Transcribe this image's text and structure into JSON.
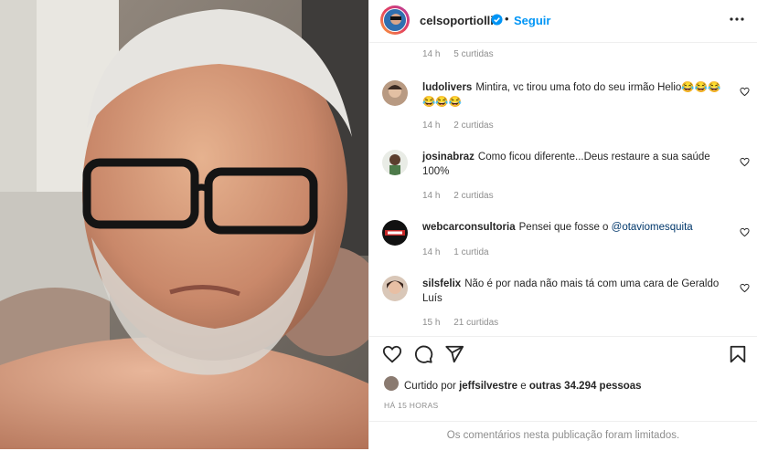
{
  "header": {
    "username": "celsoportiolli",
    "separator": "•",
    "follow_label": "Seguir"
  },
  "comments": [
    {
      "username": "",
      "text": "",
      "time": "14 h",
      "likes": "5 curtidas"
    },
    {
      "username": "ludolivers",
      "text": "Mintira, vc tirou uma foto do seu irmão Helio😂😂😂😂😂😂",
      "time": "14 h",
      "likes": "2 curtidas"
    },
    {
      "username": "josinabraz",
      "text": "Como ficou diferente...Deus restaure a sua saúde 100%",
      "time": "14 h",
      "likes": "2 curtidas"
    },
    {
      "username": "webcarconsultoria",
      "text": "Pensei que fosse o ",
      "mention": "@otaviomesquita",
      "time": "14 h",
      "likes": "1 curtida"
    },
    {
      "username": "silsfelix",
      "text": "Não é por nada não mais tá com uma cara de Geraldo Luís",
      "time": "15 h",
      "likes": "21 curtidas"
    }
  ],
  "likes": {
    "prefix": "Curtido por",
    "user": "jeffsilvestre",
    "middle": "e",
    "others": "outras 34.294 pessoas"
  },
  "timestamp": "HÁ 15 HORAS",
  "comments_limited": "Os comentários nesta publicação foram limitados.",
  "colors": {
    "accent": "#0095f6",
    "text": "#262626",
    "muted": "#8e8e8e"
  }
}
